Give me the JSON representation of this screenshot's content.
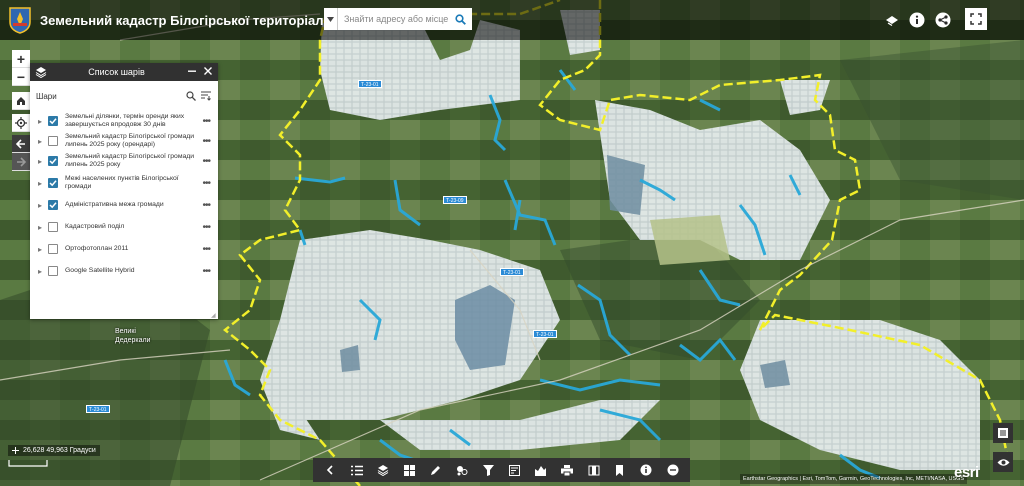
{
  "app": {
    "title": "Земельний кадастр Білогірської територіальної громади",
    "logo_icon": "coat-of-arms-icon"
  },
  "search": {
    "placeholder": "Знайти адресу або місце"
  },
  "header_buttons": [
    "layers-toggle-icon",
    "info-icon",
    "share-icon",
    "fullscreen-icon"
  ],
  "map_controls": {
    "zoom_in": "+",
    "zoom_out": "−"
  },
  "layer_panel": {
    "title": "Список шарів",
    "subtitle": "Шари",
    "layers": [
      {
        "label": "Земельні ділянки, термін оренди яких завершується впродовж 30 днів",
        "checked": true
      },
      {
        "label": "Земельний кадастр Білогірської громади липень 2025 року (орендарі)",
        "checked": false
      },
      {
        "label": "Земельний кадастр Білогірської громади липень 2025 року",
        "checked": true
      },
      {
        "label": "Межі населених пунктів Білогірської громади",
        "checked": true
      },
      {
        "label": "Адміністративна межа громади",
        "checked": true
      },
      {
        "label": "Кадастровий поділ",
        "checked": false
      },
      {
        "label": "Ортофотоплан 2011",
        "checked": false
      },
      {
        "label": "Google Satellite Hybrid",
        "checked": false
      }
    ]
  },
  "status": {
    "coordinates": "26,628 49,963 Градуси"
  },
  "attribution": "Earthstar Geographics | Esri, TomTom, Garmin, GeoTechnologies, Inc, METI/NASA, USGS",
  "esri_logo": "esri",
  "map_labels": {
    "village": "Великі\nДедеркали"
  },
  "road_shields": [
    "Т-23-01",
    "Т-23-09",
    "Т-23-01",
    "Т-23-01",
    "Т-23-01"
  ],
  "colors": {
    "boundary": "#f2ef2a",
    "parcel_fill": "#dfe6ea",
    "lease_highlight": "#29a8d8",
    "header_bg": "#2a2a2a",
    "toolbar_bg": "#323232",
    "checkbox_on": "#2c7aa8"
  }
}
